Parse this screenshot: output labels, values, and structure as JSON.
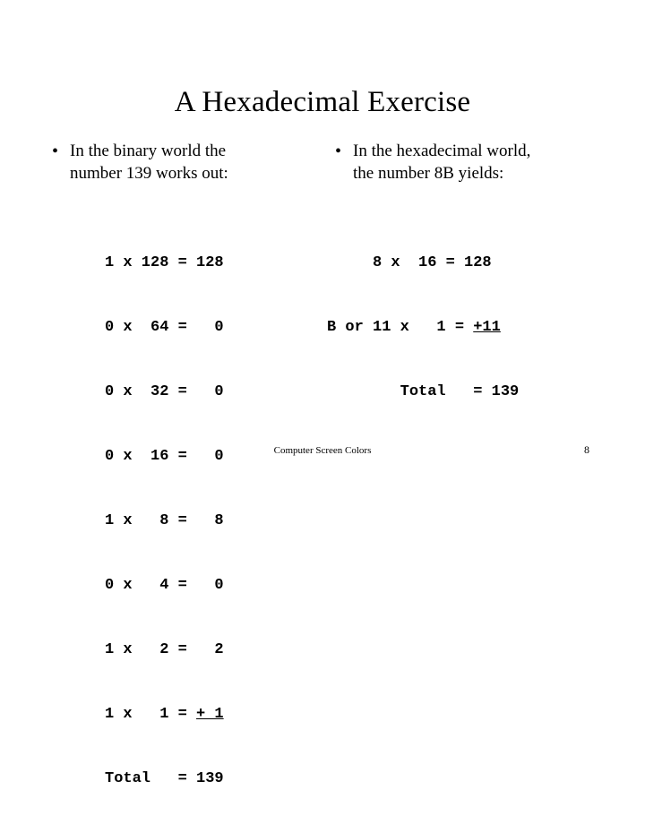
{
  "slide": {
    "title": "A Hexadecimal Exercise",
    "page_number": "8",
    "footer_note": "Computer Screen Colors",
    "bullet_marker": "•"
  },
  "bullets": {
    "left": {
      "line1": "In the binary world the",
      "line2": "number 139 works out:"
    },
    "right": {
      "line1": "In the hexadecimal world,",
      "line2": "the number 8B yields:"
    }
  },
  "binary_table": {
    "rows": [
      "1 x 128 = 128",
      "0 x  64 =   0",
      "0 x  32 =   0",
      "0 x  16 =   0",
      "1 x   8 =   8",
      "0 x   4 =   0",
      "1 x   2 =   2"
    ],
    "underlined_row_prefix": "1 x   1 = ",
    "underlined_row_value": "+ 1",
    "total_row": "Total   = 139"
  },
  "hex_table": {
    "rows": [
      "     8 x  16 = 128"
    ],
    "underlined_row_prefix": "B or 11 x   1 = ",
    "underlined_row_value": "+11",
    "total_row": "        Total   = 139"
  }
}
